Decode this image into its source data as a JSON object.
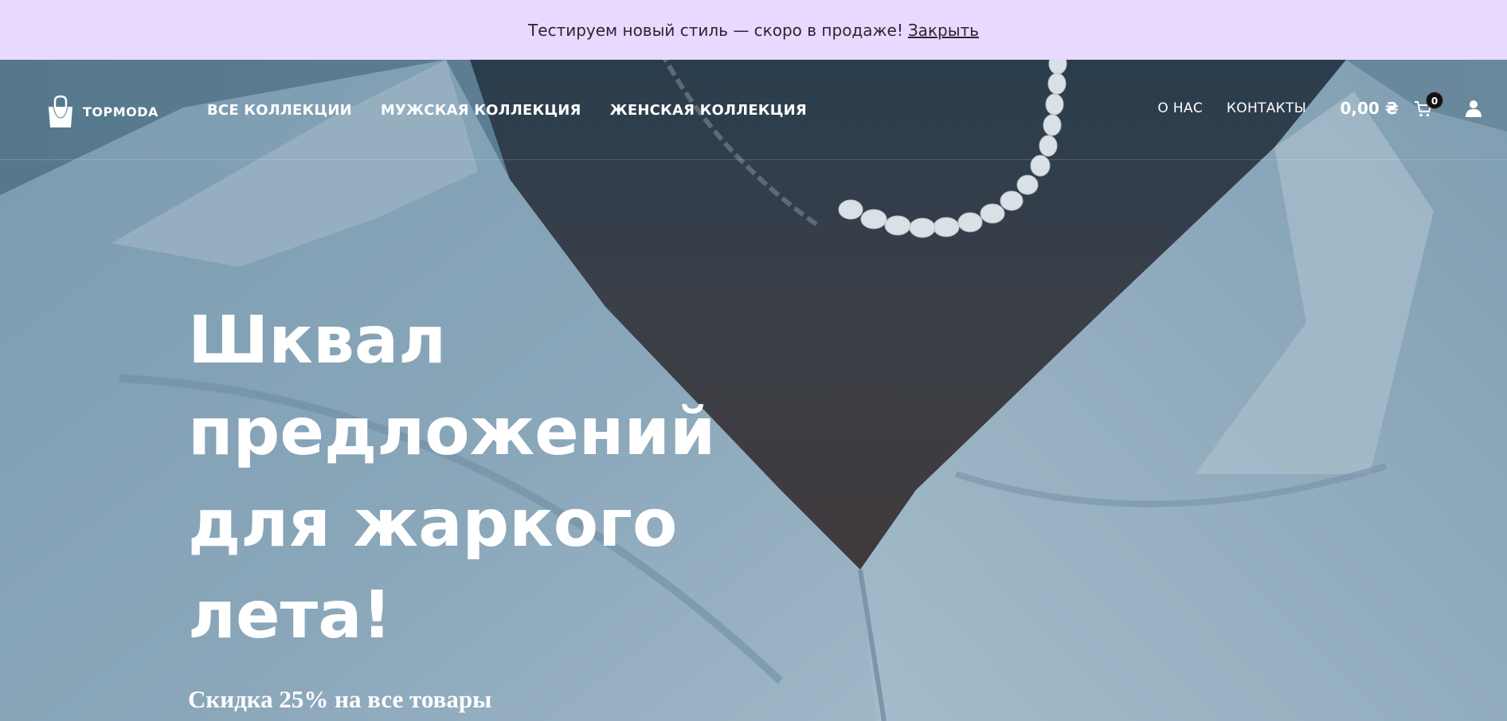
{
  "announcement": {
    "text": "Тестируем новый стиль — скоро в продаже!",
    "close_label": "Закрыть"
  },
  "header": {
    "logo_text": "TOPMODA",
    "nav": [
      {
        "label": "ВСЕ КОЛЛЕКЦИИ"
      },
      {
        "label": "МУЖСКАЯ КОЛЛЕКЦИЯ"
      },
      {
        "label": "ЖЕНСКАЯ КОЛЛЕКЦИЯ"
      }
    ],
    "secondary_nav": [
      {
        "label": "О НАС"
      },
      {
        "label": "КОНТАКТЫ"
      }
    ],
    "cart_total": "0,00 ₴",
    "cart_count": "0",
    "cart_icon": "shopping-cart-icon",
    "account_icon": "user-icon"
  },
  "hero": {
    "title": "Шквал предложений для жаркого лета!",
    "subtitle": "Скидка 25% на все товары"
  },
  "colors": {
    "announcement_bg": "#e8dafe",
    "hero_overlay": "#5a7d92",
    "text_on_hero": "#ffffff"
  }
}
